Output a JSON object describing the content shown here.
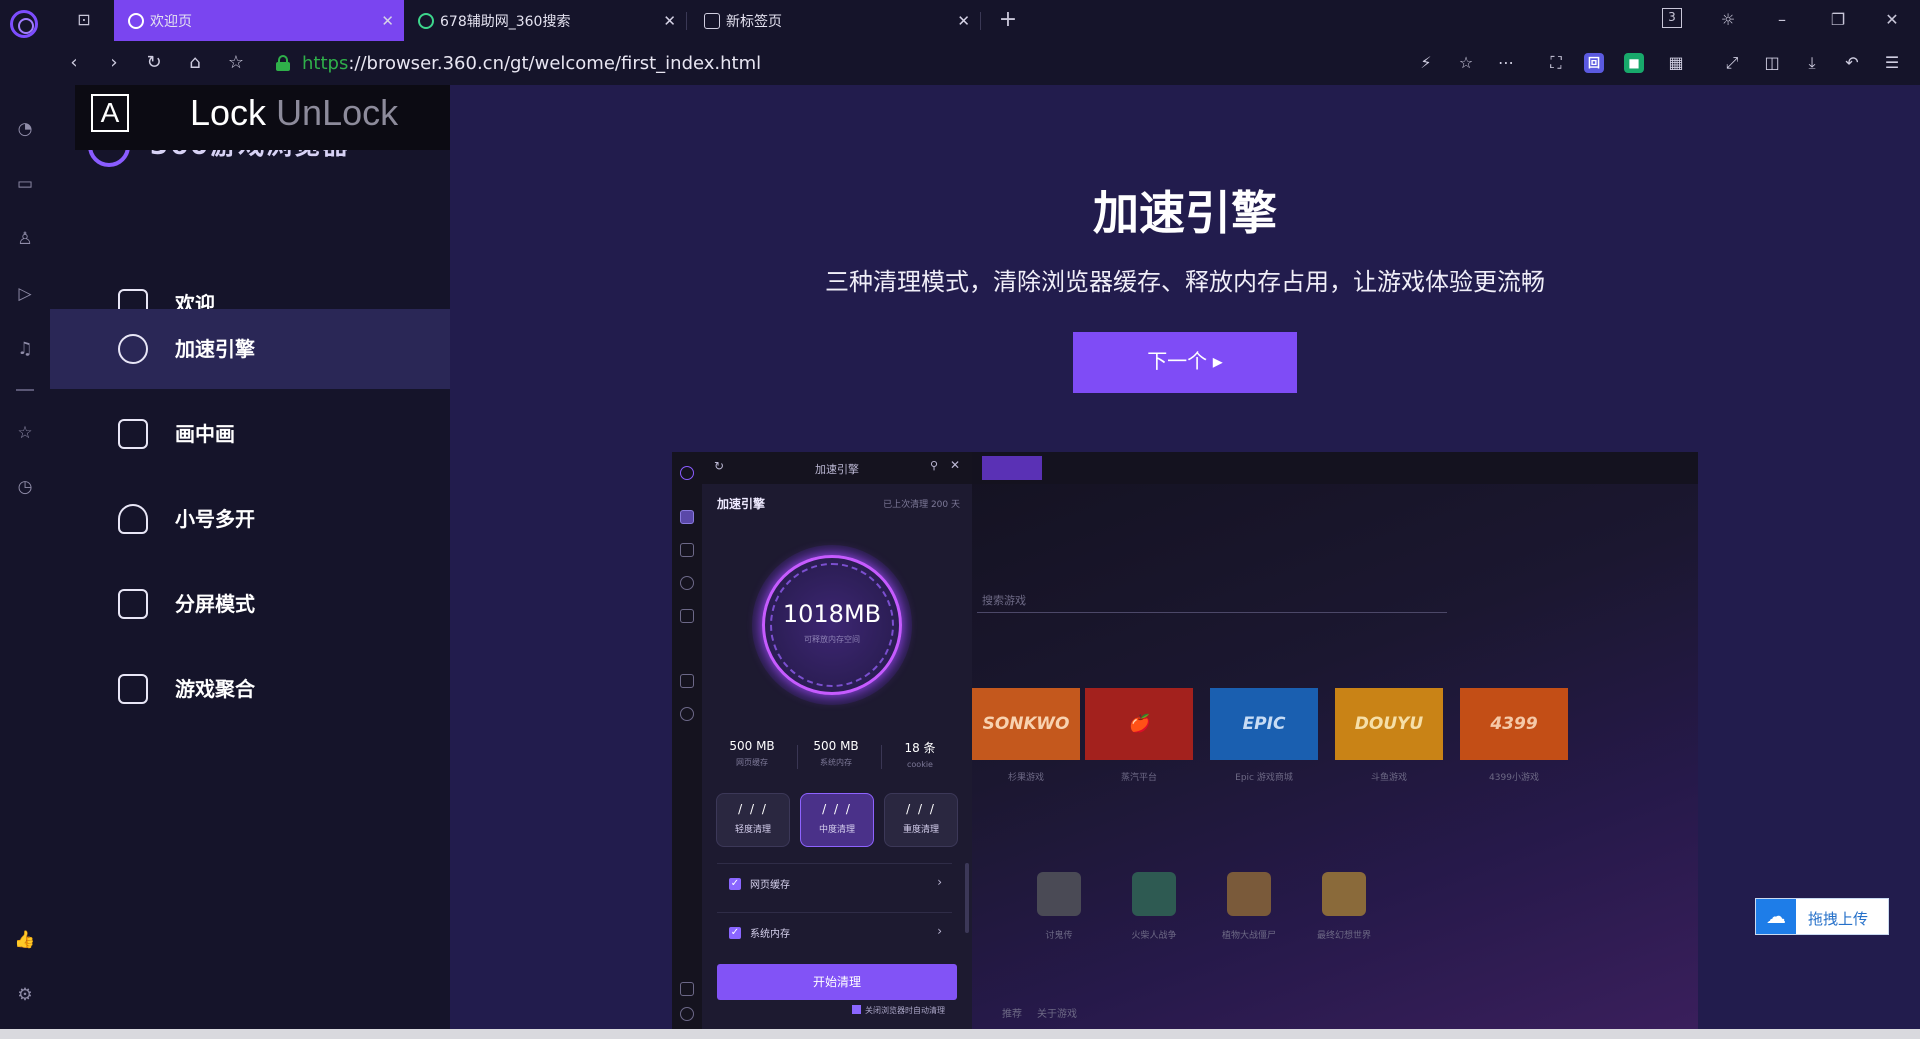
{
  "tabs": [
    {
      "label": "欢迎页",
      "active": true
    },
    {
      "label": "678辅助网_360搜索",
      "active": false
    },
    {
      "label": "新标签页",
      "active": false
    }
  ],
  "window": {
    "tab_count_badge": "3"
  },
  "address": {
    "url_protocol": "https",
    "url_rest": "://browser.360.cn/gt/welcome/first_index.html"
  },
  "toolbar": {
    "ext_blue": "回",
    "ext_green": "■"
  },
  "overlay": {
    "a_key": "A",
    "lock": "Lock",
    "unlock": "UnLock"
  },
  "navpanel": {
    "logo_text": "360游戏浏览器",
    "items": [
      {
        "label": "欢迎",
        "icon": "home-icon"
      },
      {
        "label": "加速引擎",
        "icon": "speedometer-icon",
        "active": true
      },
      {
        "label": "画中画",
        "icon": "picture-in-picture-icon"
      },
      {
        "label": "小号多开",
        "icon": "add-user-icon"
      },
      {
        "label": "分屏模式",
        "icon": "split-screen-icon"
      },
      {
        "label": "游戏聚合",
        "icon": "game-aggregate-icon"
      }
    ]
  },
  "main": {
    "title": "加速引擎",
    "subtitle": "三种清理模式，清除浏览器缓存、释放内存占用，让游戏体验更流畅",
    "next_button": "下一个 ▸"
  },
  "preview": {
    "panel_title": "加速引擎",
    "accel_title": "加速引擎",
    "days_text": "已上次清理 200 天",
    "dial_value": "1018MB",
    "dial_label": "可释放内存空间",
    "stats": [
      {
        "value": "500 MB",
        "label": "网页缓存"
      },
      {
        "value": "500 MB",
        "label": "系统内存"
      },
      {
        "value": "18 条",
        "label": "cookie"
      }
    ],
    "modes": [
      {
        "icon": "/ / /",
        "label": "轻度清理",
        "active": false
      },
      {
        "icon": "/ / /",
        "label": "中度清理",
        "active": true
      },
      {
        "icon": "/ / /",
        "label": "重度清理",
        "active": false
      }
    ],
    "checks": [
      {
        "label": "网页缓存"
      },
      {
        "label": "系统内存"
      }
    ],
    "start_button": "开始清理",
    "auto_clean": "关闭浏览器时自动清理",
    "search_hint": "搜索游戏",
    "tiles": [
      {
        "label": "SONKWO",
        "caption": "杉果游戏",
        "color": "#c4581d"
      },
      {
        "label": "🍎",
        "caption": "蒸汽平台",
        "color": "#a3211d"
      },
      {
        "label": "EPIC",
        "caption": "Epic 游戏商城",
        "color": "#1a5fb0"
      },
      {
        "label": "DOUYU",
        "caption": "斗鱼游戏",
        "color": "#c98316"
      },
      {
        "label": "4399",
        "caption": "4399小游戏",
        "color": "#c34e16"
      }
    ],
    "thumbs": [
      {
        "caption": "讨鬼传"
      },
      {
        "caption": "火柴人战争"
      },
      {
        "caption": "植物大战僵尸"
      },
      {
        "caption": "最终幻想世界"
      }
    ],
    "footer_links": [
      "推荐",
      "关于游戏"
    ]
  },
  "upload": {
    "label": "拖拽上传"
  }
}
